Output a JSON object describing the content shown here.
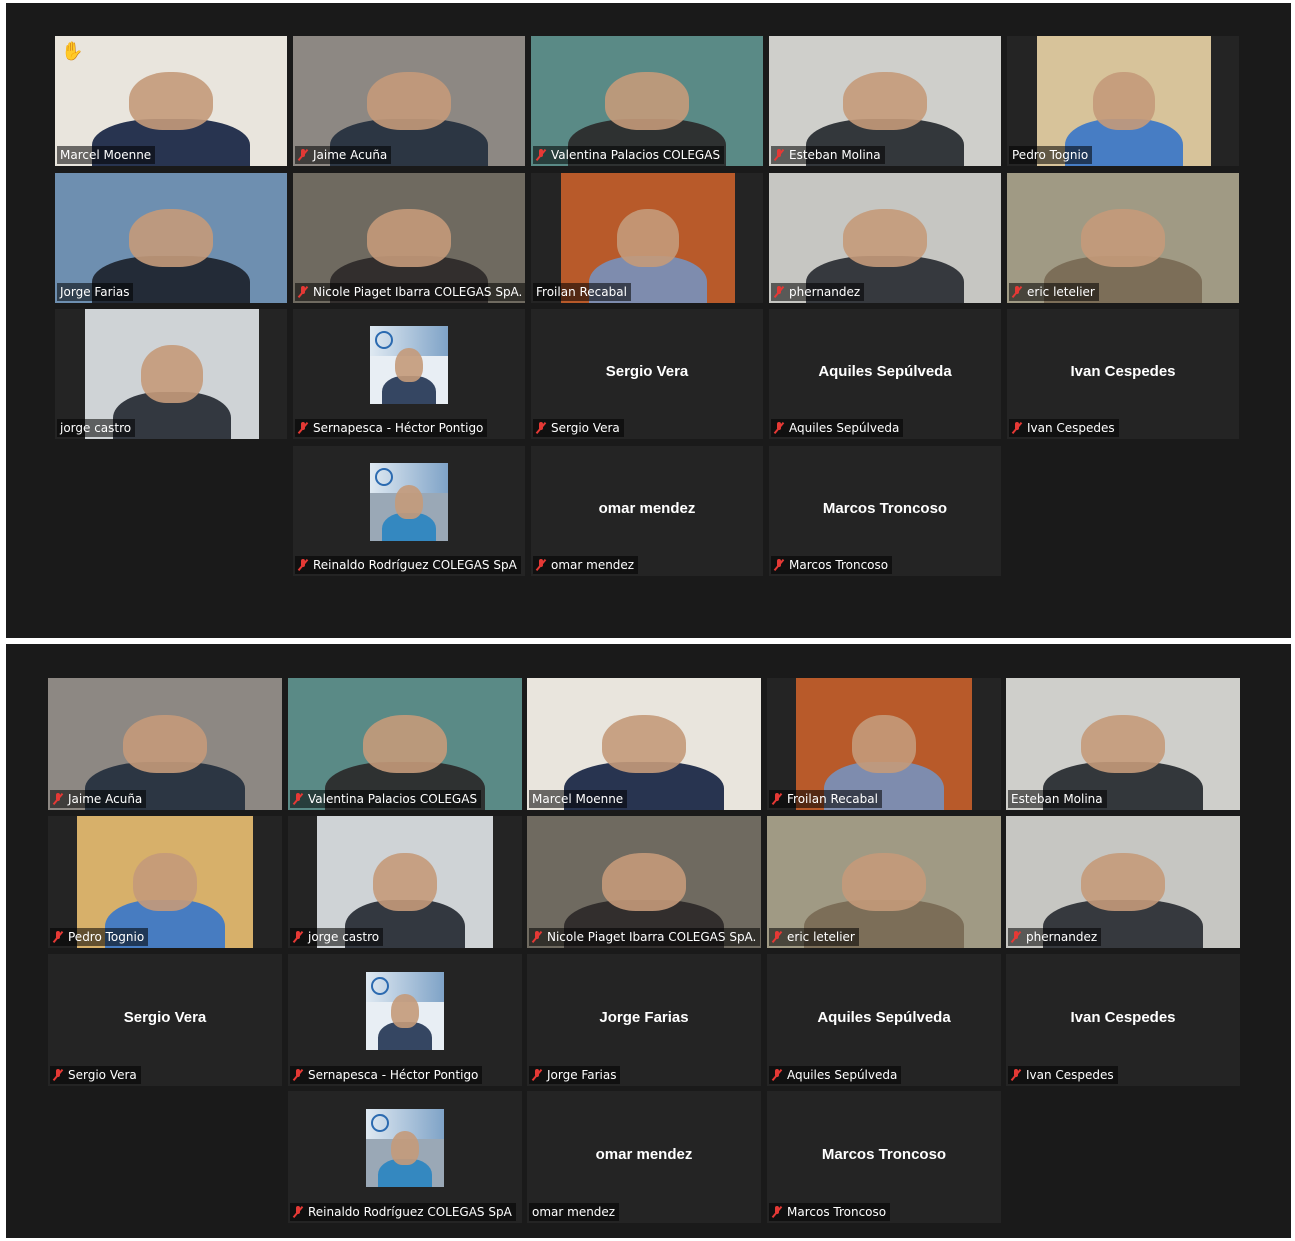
{
  "colors": {
    "background": "#1a1a1a",
    "tile": "#242424",
    "active_border": "#d6e36b",
    "muted": "#e53935"
  },
  "icons": {
    "muted": "microphone-muted-icon",
    "raised_hand": "raised-hand-icon"
  },
  "panels": [
    {
      "tiles": [
        {
          "name": "Marcel Moenne",
          "muted": false,
          "video": true,
          "hand": true,
          "bg": "#e9e5dd",
          "shirt": "#1d2a48"
        },
        {
          "name": "Jaime Acuña",
          "muted": true,
          "video": true,
          "bg": "#8d8883",
          "shirt": "#27313f"
        },
        {
          "name": "Valentina Palacios COLEGAS",
          "muted": true,
          "video": true,
          "bg": "#5a8a86",
          "shirt": "#2c2c2c"
        },
        {
          "name": "Esteban Molina",
          "muted": true,
          "video": true,
          "bg": "#cfcfcb",
          "shirt": "#2a2e33"
        },
        {
          "name": "Pedro Tognio",
          "muted": false,
          "video": true,
          "bg": "#d7c39a",
          "shirt": "#3f79c6"
        },
        {
          "name": "Jorge Farias",
          "muted": false,
          "video": true,
          "active": true,
          "bg": "#6e8fb0",
          "shirt": "#1f2630"
        },
        {
          "name": "Nicole Piaget Ibarra COLEGAS SpA.",
          "muted": true,
          "video": true,
          "bg": "#6f6a60",
          "shirt": "#2e2b2a"
        },
        {
          "name": "Froilan Recabal",
          "muted": false,
          "video": true,
          "bg": "#b85a2a",
          "shirt": "#7a8fb5"
        },
        {
          "name": "phernandez",
          "muted": true,
          "video": true,
          "bg": "#c6c6c2",
          "shirt": "#2e3137"
        },
        {
          "name": "eric letelier",
          "muted": true,
          "video": true,
          "bg": "#a09a84",
          "shirt": "#7a6b55"
        },
        {
          "name": "jorge castro",
          "muted": false,
          "video": true,
          "bg": "#cfd3d6",
          "shirt": "#2a2f38"
        },
        {
          "name": "Sernapesca - Héctor Pontigo",
          "muted": true,
          "video": "thumb",
          "bg": "#e8eef4",
          "shirt": "#2b3c5a"
        },
        {
          "name": "Sergio Vera",
          "muted": true,
          "video": false
        },
        {
          "name": "Aquiles Sepúlveda",
          "muted": true,
          "video": false
        },
        {
          "name": "Ivan Cespedes",
          "muted": true,
          "video": false
        },
        {
          "name": "Reinaldo Rodríguez  COLEGAS SpA",
          "muted": true,
          "video": "thumb",
          "bg": "#9aa8b6",
          "shirt": "#2e86c1"
        },
        {
          "name": "omar mendez",
          "muted": true,
          "video": false
        },
        {
          "name": "Marcos Troncoso",
          "muted": true,
          "video": false
        }
      ]
    },
    {
      "tiles": [
        {
          "name": "Jaime Acuña",
          "muted": true,
          "video": true,
          "bg": "#8d8883",
          "shirt": "#27313f"
        },
        {
          "name": "Valentina Palacios COLEGAS",
          "muted": true,
          "video": true,
          "bg": "#5a8a86",
          "shirt": "#2c2c2c"
        },
        {
          "name": "Marcel Moenne",
          "muted": false,
          "video": true,
          "bg": "#e9e5dd",
          "shirt": "#1d2a48"
        },
        {
          "name": "Froilan Recabal",
          "muted": true,
          "video": true,
          "bg": "#b85a2a",
          "shirt": "#7a8fb5"
        },
        {
          "name": "Esteban Molina",
          "muted": false,
          "video": true,
          "active": true,
          "bg": "#cfcfcb",
          "shirt": "#2a2e33"
        },
        {
          "name": "Pedro Tognio",
          "muted": true,
          "video": true,
          "bg": "#d7b06a",
          "shirt": "#3f79c6"
        },
        {
          "name": "jorge castro",
          "muted": true,
          "video": true,
          "bg": "#cfd3d6",
          "shirt": "#2a2f38"
        },
        {
          "name": "Nicole Piaget Ibarra COLEGAS SpA.",
          "muted": true,
          "video": true,
          "bg": "#6f6a60",
          "shirt": "#2e2b2a"
        },
        {
          "name": "eric letelier",
          "muted": true,
          "video": true,
          "bg": "#a09a84",
          "shirt": "#7a6b55"
        },
        {
          "name": "phernandez",
          "muted": true,
          "video": true,
          "bg": "#c6c6c2",
          "shirt": "#2e3137"
        },
        {
          "name": "Sergio Vera",
          "muted": true,
          "video": false
        },
        {
          "name": "Sernapesca - Héctor Pontigo",
          "muted": true,
          "video": "thumb",
          "bg": "#e8eef4",
          "shirt": "#2b3c5a"
        },
        {
          "name": "Jorge Farias",
          "muted": true,
          "video": false
        },
        {
          "name": "Aquiles Sepúlveda",
          "muted": true,
          "video": false
        },
        {
          "name": "Ivan Cespedes",
          "muted": true,
          "video": false
        },
        {
          "name": "Reinaldo Rodríguez  COLEGAS SpA",
          "muted": true,
          "video": "thumb",
          "bg": "#9aa8b6",
          "shirt": "#2e86c1"
        },
        {
          "name": "omar mendez",
          "muted": false,
          "video": false
        },
        {
          "name": "Marcos Troncoso",
          "muted": true,
          "video": false
        }
      ]
    }
  ]
}
